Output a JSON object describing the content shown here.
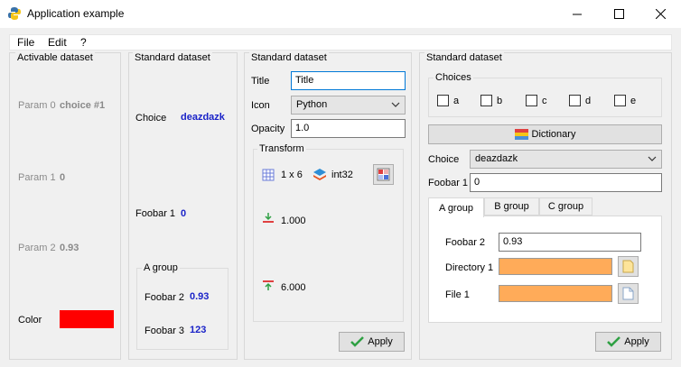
{
  "window": {
    "title": "Application example"
  },
  "menu": [
    "File",
    "Edit",
    "?"
  ],
  "panel1": {
    "title": "Activable dataset",
    "params": [
      {
        "label": "Param 0",
        "value": "choice #1"
      },
      {
        "label": "Param 1",
        "value": "0"
      },
      {
        "label": "Param 2",
        "value": "0.93"
      }
    ],
    "color_label": "Color",
    "color_value": "#ff0000"
  },
  "panel2": {
    "title": "Standard dataset",
    "choice_label": "Choice",
    "choice_value": "deazdazk",
    "foobar1_label": "Foobar 1",
    "foobar1_value": "0",
    "group_title": "A group",
    "foobar2_label": "Foobar 2",
    "foobar2_value": "0.93",
    "foobar3_label": "Foobar 3",
    "foobar3_value": "123"
  },
  "panel3": {
    "title": "Standard dataset",
    "title_label": "Title",
    "title_value": "Title",
    "icon_label": "Icon",
    "icon_value": "Python",
    "opacity_label": "Opacity",
    "opacity_value": "1.0",
    "transform_title": "Transform",
    "shape": "1 x 6",
    "dtype": "int32",
    "min_value": "1.000",
    "max_value": "6.000",
    "apply_label": "Apply"
  },
  "panel4": {
    "title": "Standard dataset",
    "choices_title": "Choices",
    "checkboxes": [
      "a",
      "b",
      "c",
      "d",
      "e"
    ],
    "dictionary_label": "Dictionary",
    "choice_label": "Choice",
    "choice_value": "deazdazk",
    "foobar1_label": "Foobar 1",
    "foobar1_value": "0",
    "tabs": [
      "A group",
      "B group",
      "C group"
    ],
    "foobar2_label": "Foobar 2",
    "foobar2_value": "0.93",
    "directory_label": "Directory 1",
    "file_label": "File 1",
    "apply_label": "Apply"
  }
}
